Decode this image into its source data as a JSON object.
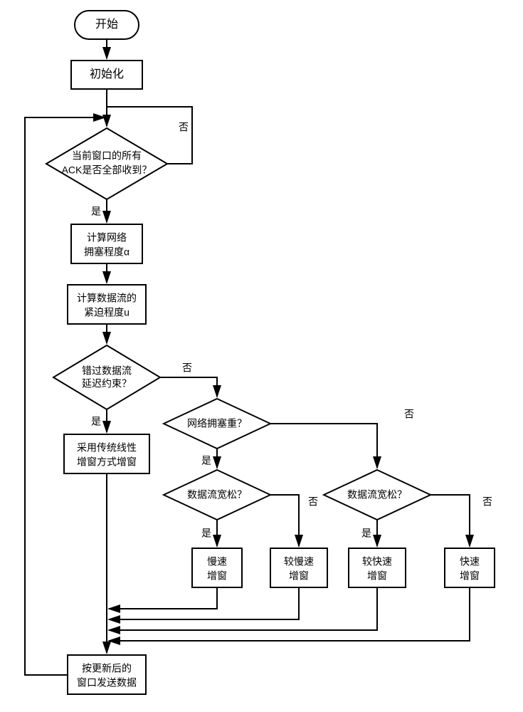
{
  "chart_data": {
    "type": "flowchart",
    "title": "",
    "nodes": {
      "start": {
        "shape": "terminator",
        "label": "开始"
      },
      "init": {
        "shape": "process",
        "label": "初始化"
      },
      "d_ack": {
        "shape": "decision",
        "label_line1": "当前窗口的所有",
        "label_line2": "ACK是否全部收到？"
      },
      "calc_alpha": {
        "shape": "process",
        "label_line1": "计算网络",
        "label_line2": "拥塞程度α"
      },
      "calc_u": {
        "shape": "process",
        "label_line1": "计算数据流的",
        "label_line2": "紧迫程度u"
      },
      "d_miss": {
        "shape": "decision",
        "label_line1": "错过数据流",
        "label_line2": "延迟约束？"
      },
      "linear": {
        "shape": "process",
        "label_line1": "采用传统线性",
        "label_line2": "增窗方式增窗"
      },
      "d_cong": {
        "shape": "decision",
        "label": "网络拥塞重？"
      },
      "d_relax1": {
        "shape": "decision",
        "label": "数据流宽松？"
      },
      "d_relax2": {
        "shape": "decision",
        "label": "数据流宽松？"
      },
      "slow": {
        "shape": "process",
        "label_line1": "慢速",
        "label_line2": "增窗"
      },
      "slower": {
        "shape": "process",
        "label_line1": "较慢速",
        "label_line2": "增窗"
      },
      "faster": {
        "shape": "process",
        "label_line1": "较快速",
        "label_line2": "增窗"
      },
      "fast": {
        "shape": "process",
        "label_line1": "快速",
        "label_line2": "增窗"
      },
      "send": {
        "shape": "process",
        "label_line1": "按更新后的",
        "label_line2": "窗口发送数据"
      }
    },
    "labels": {
      "yes": "是",
      "no": "否"
    },
    "edges": [
      {
        "from": "start",
        "to": "init"
      },
      {
        "from": "init",
        "to": "d_ack"
      },
      {
        "from": "d_ack",
        "to": "calc_alpha",
        "label": "是"
      },
      {
        "from": "d_ack",
        "to": "d_ack",
        "label": "否",
        "note": "loop-right-top"
      },
      {
        "from": "calc_alpha",
        "to": "calc_u"
      },
      {
        "from": "calc_u",
        "to": "d_miss"
      },
      {
        "from": "d_miss",
        "to": "linear",
        "label": "是"
      },
      {
        "from": "d_miss",
        "to": "d_cong",
        "label": "否"
      },
      {
        "from": "d_cong",
        "to": "d_relax1",
        "label": "是"
      },
      {
        "from": "d_cong",
        "to": "d_relax2",
        "label": "否"
      },
      {
        "from": "d_relax1",
        "to": "slow",
        "label": "是"
      },
      {
        "from": "d_relax1",
        "to": "slower",
        "label": "否"
      },
      {
        "from": "d_relax2",
        "to": "faster",
        "label": "是"
      },
      {
        "from": "d_relax2",
        "to": "fast",
        "label": "否"
      },
      {
        "from": "linear",
        "to": "send"
      },
      {
        "from": "slow",
        "to": "send"
      },
      {
        "from": "slower",
        "to": "send"
      },
      {
        "from": "faster",
        "to": "send"
      },
      {
        "from": "fast",
        "to": "send"
      },
      {
        "from": "send",
        "to": "d_ack",
        "note": "loop-left"
      }
    ]
  }
}
